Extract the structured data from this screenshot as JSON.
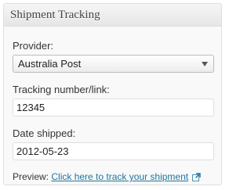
{
  "panel": {
    "title": "Shipment Tracking"
  },
  "provider": {
    "label": "Provider:",
    "selected": "Australia Post"
  },
  "tracking": {
    "label": "Tracking number/link:",
    "value": "12345"
  },
  "date": {
    "label": "Date shipped:",
    "value": "2012-05-23"
  },
  "preview": {
    "label": "Preview:",
    "link_text": "Click here to track your shipment",
    "icon": "external-link-icon"
  },
  "colors": {
    "link": "#21759b",
    "header_bg": "#ececec",
    "border": "#dfdfdf"
  }
}
